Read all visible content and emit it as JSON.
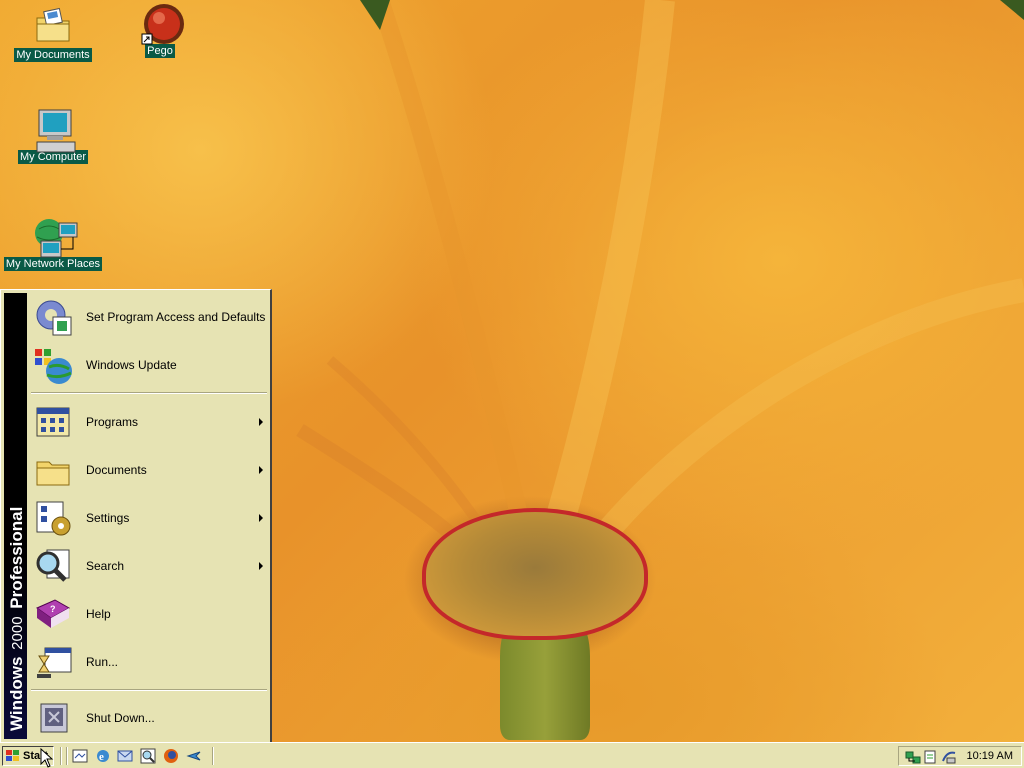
{
  "desktop": {
    "icons": [
      {
        "label": "My Documents"
      },
      {
        "label": "Pego"
      },
      {
        "label": "My Computer"
      },
      {
        "label": "My Network Places"
      }
    ]
  },
  "start_menu": {
    "banner": {
      "brand": "Windows",
      "version": "2000",
      "edition": "Professional"
    },
    "top_items": [
      {
        "label": "Set Program Access and Defaults",
        "icon": "program-access-icon"
      },
      {
        "label": "Windows Update",
        "icon": "windows-update-icon"
      }
    ],
    "items": [
      {
        "label": "Programs",
        "icon": "programs-icon",
        "submenu": true
      },
      {
        "label": "Documents",
        "icon": "documents-folder-icon",
        "submenu": true
      },
      {
        "label": "Settings",
        "icon": "settings-icon",
        "submenu": true
      },
      {
        "label": "Search",
        "icon": "search-icon",
        "submenu": true
      },
      {
        "label": "Help",
        "icon": "help-book-icon",
        "submenu": false
      },
      {
        "label": "Run...",
        "icon": "run-icon",
        "submenu": false
      }
    ],
    "shutdown": {
      "label": "Shut Down...",
      "icon": "shutdown-icon"
    }
  },
  "taskbar": {
    "start_label": "Start",
    "quick_launch": [
      "show-desktop-icon",
      "internet-explorer-icon",
      "outlook-express-icon",
      "media-icon",
      "firefox-icon",
      "arrow-icon"
    ],
    "tray": {
      "icons": [
        "network-icon",
        "volume-icon",
        "connection-icon"
      ],
      "clock": "10:19 AM"
    }
  },
  "colors": {
    "menu_bg": "#e6e3b3",
    "label_bg": "#0a5a46"
  }
}
